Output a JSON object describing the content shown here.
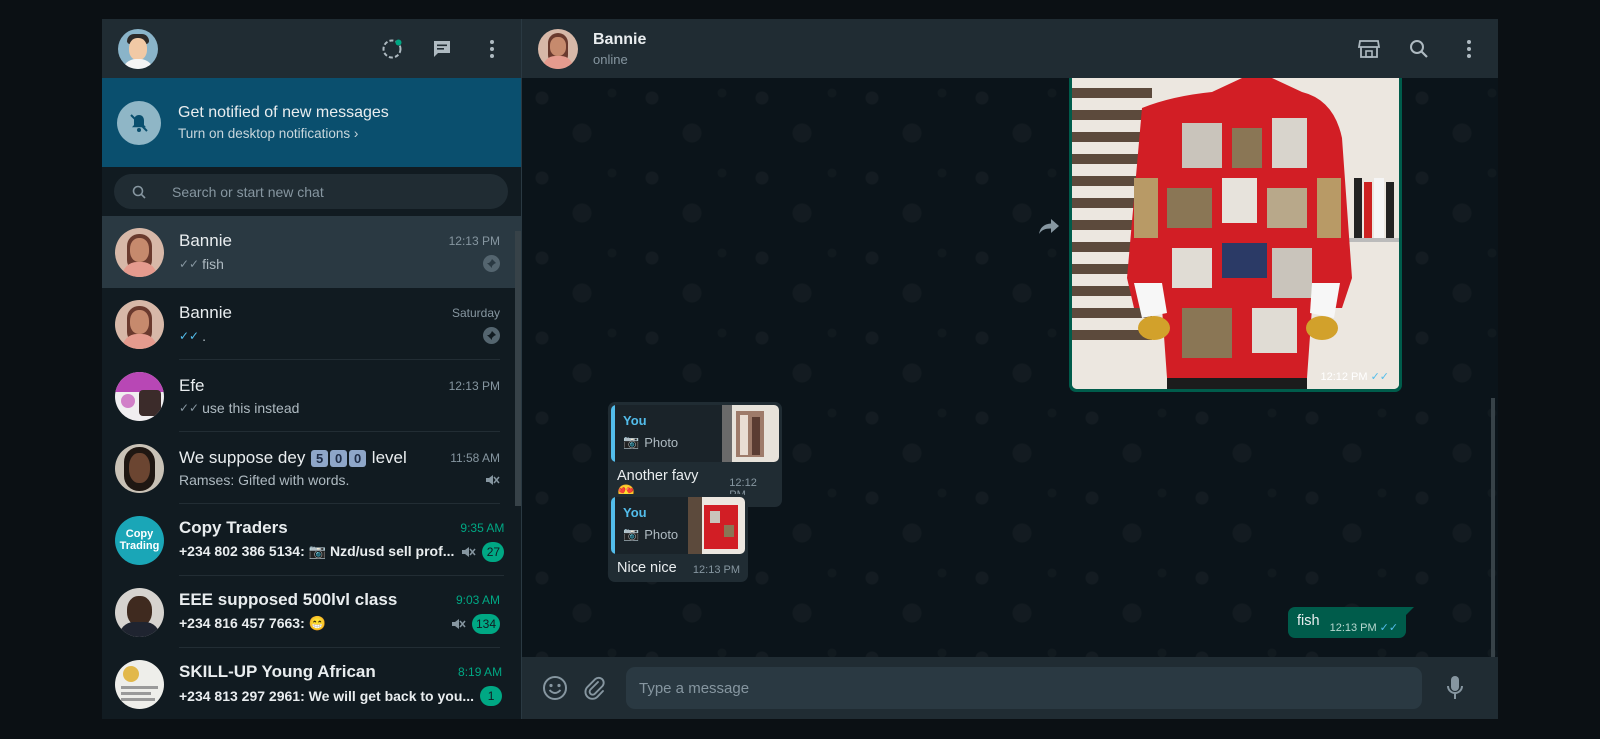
{
  "left_header": {
    "icons": [
      "status-icon",
      "new-chat-icon",
      "menu-icon"
    ]
  },
  "notification": {
    "title": "Get notified of new messages",
    "subtitle": "Turn on desktop notifications ›"
  },
  "search": {
    "placeholder": "Search or start new chat"
  },
  "chats": [
    {
      "name": "Bannie",
      "time": "12:13 PM",
      "ticks": "✓✓",
      "ticks_color": "grey",
      "preview": "fish",
      "pinned": true,
      "active": true
    },
    {
      "name": "Bannie",
      "time": "Saturday",
      "ticks": "✓✓",
      "ticks_color": "blue",
      "preview": ".",
      "pinned": true
    },
    {
      "name": "Efe",
      "time": "12:13 PM",
      "ticks": "✓✓",
      "ticks_color": "grey",
      "preview": "use this instead"
    },
    {
      "name_prefix": "We suppose dey",
      "name_digits": [
        "5",
        "0",
        "0"
      ],
      "name_suffix": "level",
      "time": "11:58 AM",
      "preview": "Ramses: Gifted with words.",
      "muted": true
    },
    {
      "name": "Copy Traders",
      "avatar_text_1": "Copy",
      "avatar_text_2": "Trading",
      "time": "9:35 AM",
      "preview_prefix": "+234 802 386 5134:",
      "preview": "Nzd/usd sell prof...",
      "muted": true,
      "unread": "27"
    },
    {
      "name": "EEE supposed 500lvl class",
      "time": "9:03 AM",
      "preview": "+234 816 457 7663: 😁",
      "muted": true,
      "unread": "134"
    },
    {
      "name": "SKILL-UP Young African",
      "time": "8:19 AM",
      "preview": "+234 813 297 2961: We will get back to you...",
      "unread": "1"
    }
  ],
  "conversation": {
    "name": "Bannie",
    "status": "online",
    "header_icons": [
      "catalog-icon",
      "search-icon",
      "menu-icon"
    ],
    "image_message": {
      "time": "12:12 PM",
      "ticks": "✓✓"
    },
    "reply_1": {
      "quoted_author": "You",
      "quoted_type": "Photo",
      "text": "Another favy 😍",
      "time": "12:12 PM"
    },
    "reply_2": {
      "quoted_author": "You",
      "quoted_type": "Photo",
      "text": "Nice nice",
      "time": "12:13 PM"
    },
    "outgoing": {
      "text": "fish",
      "time": "12:13 PM",
      "ticks": "✓✓"
    }
  },
  "composer": {
    "placeholder": "Type a message"
  },
  "colors": {
    "accent": "#00a884",
    "outgoing_bubble": "#005c4b",
    "incoming_bubble": "#202c33",
    "notification_banner": "#0a4f6e",
    "read_ticks": "#53bdeb"
  }
}
